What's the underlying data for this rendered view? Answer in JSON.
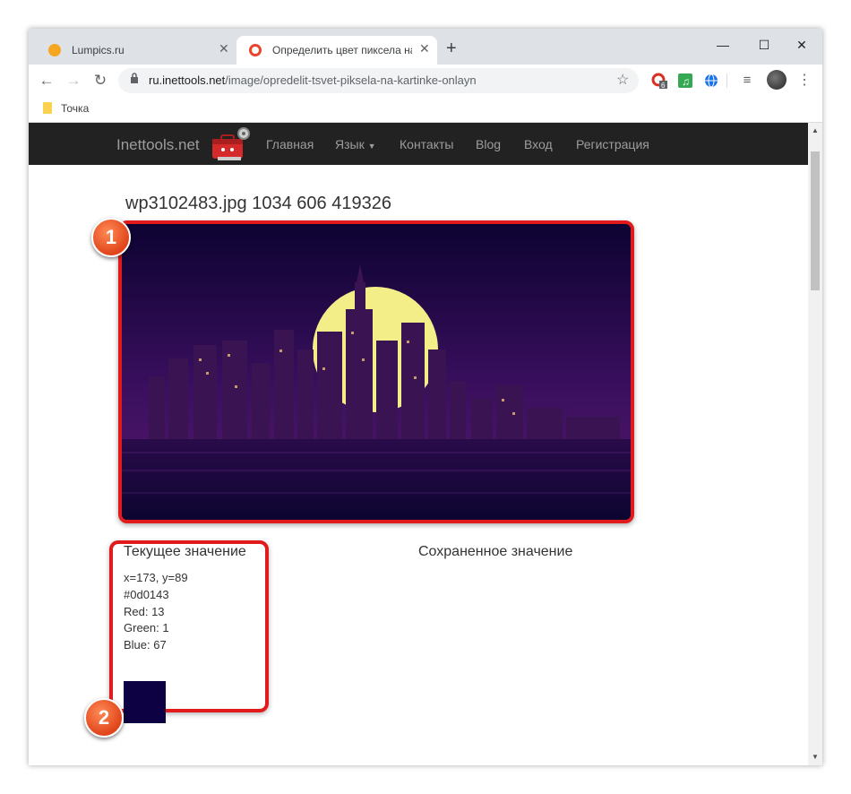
{
  "browser": {
    "tabs": [
      {
        "title": "Lumpics.ru",
        "active": false,
        "favicon_color": "#f5a623"
      },
      {
        "title": "Определить цвет пиксела на кар",
        "active": true,
        "favicon_color": "#e8452c"
      }
    ],
    "address": {
      "host": "ru.inettools.net",
      "path": "/image/opredelit-tsvet-piksela-na-kartinke-onlayn"
    },
    "bookmarks": [
      {
        "label": "Точка"
      }
    ],
    "extension_badge": "6"
  },
  "site": {
    "brand": "Inettools.net",
    "nav": [
      {
        "label": "Главная"
      },
      {
        "label": "Язык"
      },
      {
        "label": "Контакты"
      },
      {
        "label": "Blog"
      },
      {
        "label": "Вход"
      },
      {
        "label": "Регистрация"
      }
    ]
  },
  "content": {
    "file_title": "wp3102483.jpg 1034 606 419326",
    "current": {
      "heading": "Текущее значение",
      "coords": "x=173, y=89",
      "hex": "#0d0143",
      "red": "Red: 13",
      "green": "Green: 1",
      "blue": "Blue: 67",
      "swatch_color": "#0d0143"
    },
    "saved": {
      "heading": "Сохраненное значение"
    }
  },
  "markers": [
    "1",
    "2"
  ],
  "colors": {
    "highlight": "#e11b1b",
    "navbar": "#222222",
    "marker": "#e0451b"
  }
}
